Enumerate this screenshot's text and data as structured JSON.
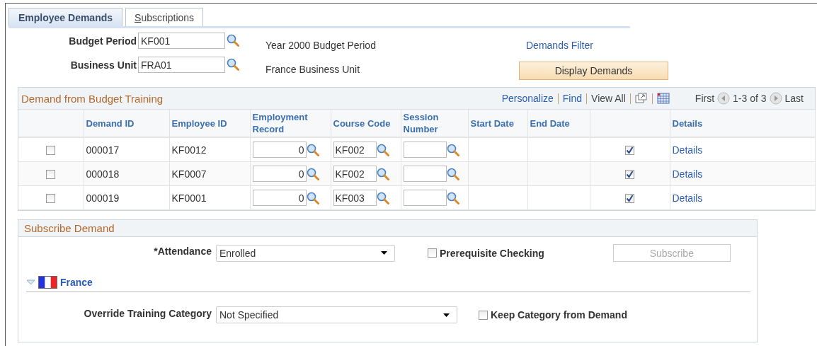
{
  "tabs": [
    {
      "label": "Employee Demands",
      "selected": true,
      "underline_first": false
    },
    {
      "label": "Subscriptions",
      "selected": false,
      "underline_first": true
    }
  ],
  "header_fields": [
    {
      "label": "Budget Period",
      "value": "KF001",
      "description": "Year 2000 Budget Period"
    },
    {
      "label": "Business Unit",
      "value": "FRA01",
      "description": "France Business Unit"
    }
  ],
  "demands_filter_link": "Demands Filter",
  "display_demands_button": "Display Demands",
  "grid": {
    "title": "Demand from Budget Training",
    "toolbar_links": [
      "Personalize",
      "Find",
      "View All"
    ],
    "pager": {
      "first": "First",
      "range": "1-3 of 3",
      "last": "Last"
    },
    "columns": [
      {
        "kind": "select"
      },
      {
        "kind": "text",
        "label": "Demand ID"
      },
      {
        "kind": "text",
        "label": "Employee ID"
      },
      {
        "kind": "number_lookup",
        "label": "Employment Record"
      },
      {
        "kind": "lookup",
        "label": "Course Code"
      },
      {
        "kind": "lookup",
        "label": "Session Number"
      },
      {
        "kind": "text",
        "label": "Start Date"
      },
      {
        "kind": "text",
        "label": "End Date"
      },
      {
        "kind": "flag"
      },
      {
        "kind": "link",
        "label": "Details"
      }
    ],
    "rows": [
      {
        "cells": [
          {
            "checked": false
          },
          {
            "text": "000017"
          },
          {
            "text": "KF0012"
          },
          {
            "value": "0"
          },
          {
            "value": "KF002"
          },
          {},
          {},
          {},
          {
            "checked": true
          },
          {
            "text": "Details"
          }
        ]
      },
      {
        "cells": [
          {
            "checked": false
          },
          {
            "text": "000018"
          },
          {
            "text": "KF0007"
          },
          {
            "value": "0"
          },
          {
            "value": "KF002"
          },
          {},
          {},
          {},
          {
            "checked": true
          },
          {
            "text": "Details"
          }
        ]
      },
      {
        "cells": [
          {
            "checked": false
          },
          {
            "text": "000019"
          },
          {
            "text": "KF0001"
          },
          {
            "value": "0"
          },
          {
            "value": "KF003"
          },
          {},
          {},
          {},
          {
            "checked": true
          },
          {
            "text": "Details"
          }
        ]
      }
    ]
  },
  "subscribe": {
    "title": "Subscribe Demand",
    "attendance": {
      "label": "*Attendance",
      "value": "Enrolled"
    },
    "prerequisite": {
      "label": "Prerequisite Checking",
      "checked": false
    },
    "subscribe_button": {
      "label": "Subscribe",
      "disabled": true
    },
    "country": {
      "name": "France",
      "expanded": true
    },
    "override": {
      "label": "Override Training Category",
      "value": "Not Specified"
    },
    "keep_category": {
      "label": "Keep Category from Demand",
      "checked": false
    }
  }
}
